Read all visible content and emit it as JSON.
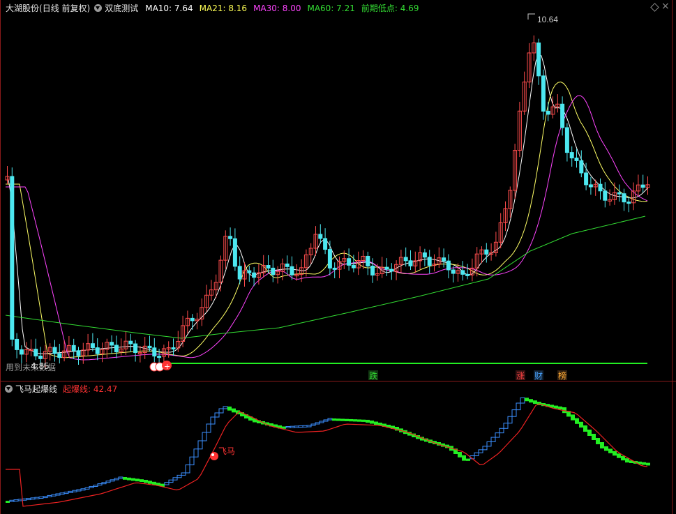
{
  "header": {
    "stock_name": "大湖股份",
    "period": "(日线 前复权)",
    "indicator": "双底测试",
    "ma": [
      {
        "label": "MA10: 7.64",
        "color": "#ffffff"
      },
      {
        "label": "MA21: 8.16",
        "color": "#ffff55"
      },
      {
        "label": "MA30: 8.00",
        "color": "#ff44ff"
      },
      {
        "label": "MA60: 7.21",
        "color": "#33dd33"
      },
      {
        "label": "前期低点: 4.69",
        "color": "#33dd33"
      }
    ]
  },
  "main_chart": {
    "high_label": "10.64",
    "low_label": "4.85",
    "overlay_text": "用到未来数据",
    "markers": [
      {
        "text": "跌",
        "color": "#33dd33"
      },
      {
        "text": "涨",
        "color": "#ff4444"
      },
      {
        "text": "财",
        "color": "#4aa3ff"
      },
      {
        "text": "榜",
        "color": "#ffaa33"
      }
    ]
  },
  "sub_chart": {
    "title": "飞马起爆线",
    "value_label": "起爆线: 42.47",
    "signal_label": "飞马"
  },
  "colors": {
    "up": "#ff4d4d",
    "down": "#4de8f0",
    "ma10": "#ffffff",
    "ma21": "#ffff66",
    "ma30": "#ff44ff",
    "ma60": "#33dd33",
    "support": "#22ee22",
    "divider": "#8a1a1a"
  },
  "icons": [
    "menu-circle-icon",
    "diamond-icon",
    "close-icon",
    "signal-buy-icon",
    "feima-ball-icon"
  ]
}
